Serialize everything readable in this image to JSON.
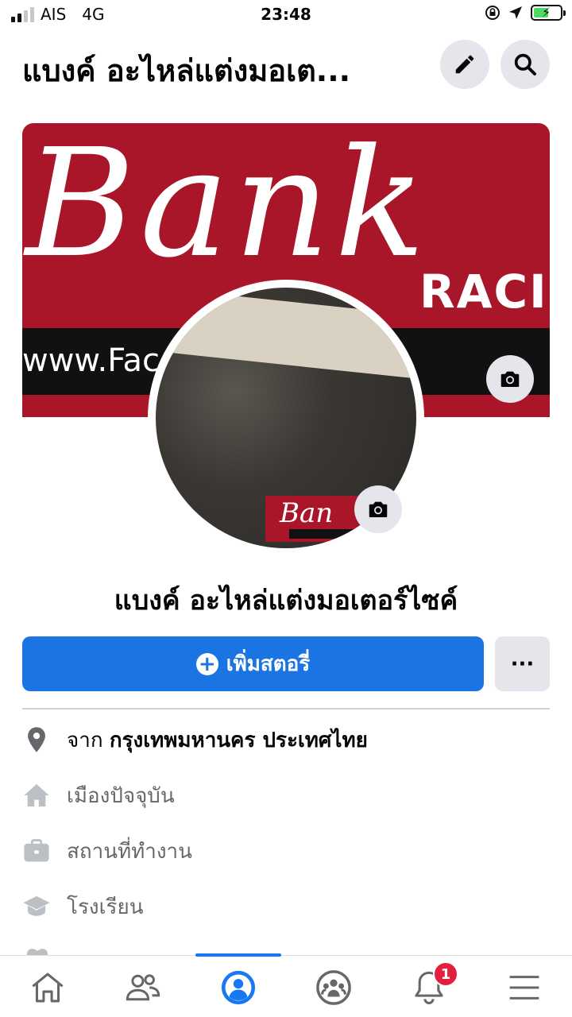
{
  "status_bar": {
    "carrier": "AIS",
    "network": "4G",
    "time": "23:48"
  },
  "header": {
    "title": "แบงค์ อะไหล่แต่งมอเต..."
  },
  "cover": {
    "brand_text": "Bank",
    "racing_text": "RACI",
    "url_text": "www.Fac                   awa.con"
  },
  "avatar": {
    "sticker_text": "Ban"
  },
  "profile": {
    "name": "แบงค์ อะไหล่แต่งมอเตอร์ไซค์"
  },
  "actions": {
    "add_story_label": "เพิ่มสตอรี่",
    "more_label": "···"
  },
  "details": [
    {
      "prefix": "จาก",
      "value": "กรุงเทพมหานคร ประเทศไทย",
      "icon": "location-pin-icon"
    },
    {
      "label": "เมืองปัจจุบัน",
      "icon": "home-icon"
    },
    {
      "label": "สถานที่ทำงาน",
      "icon": "briefcase-icon"
    },
    {
      "label": "โรงเรียน",
      "icon": "graduation-cap-icon"
    }
  ],
  "bottom_nav": {
    "items": [
      "home-icon",
      "friends-icon",
      "profile-icon",
      "groups-icon",
      "notifications-icon",
      "menu-icon"
    ],
    "active": "profile-icon",
    "notification_count": "1"
  },
  "colors": {
    "accent": "#1877f2",
    "button_blue": "#1b74e4",
    "brand_red": "#a9162a",
    "badge_red": "#e41e3f"
  }
}
